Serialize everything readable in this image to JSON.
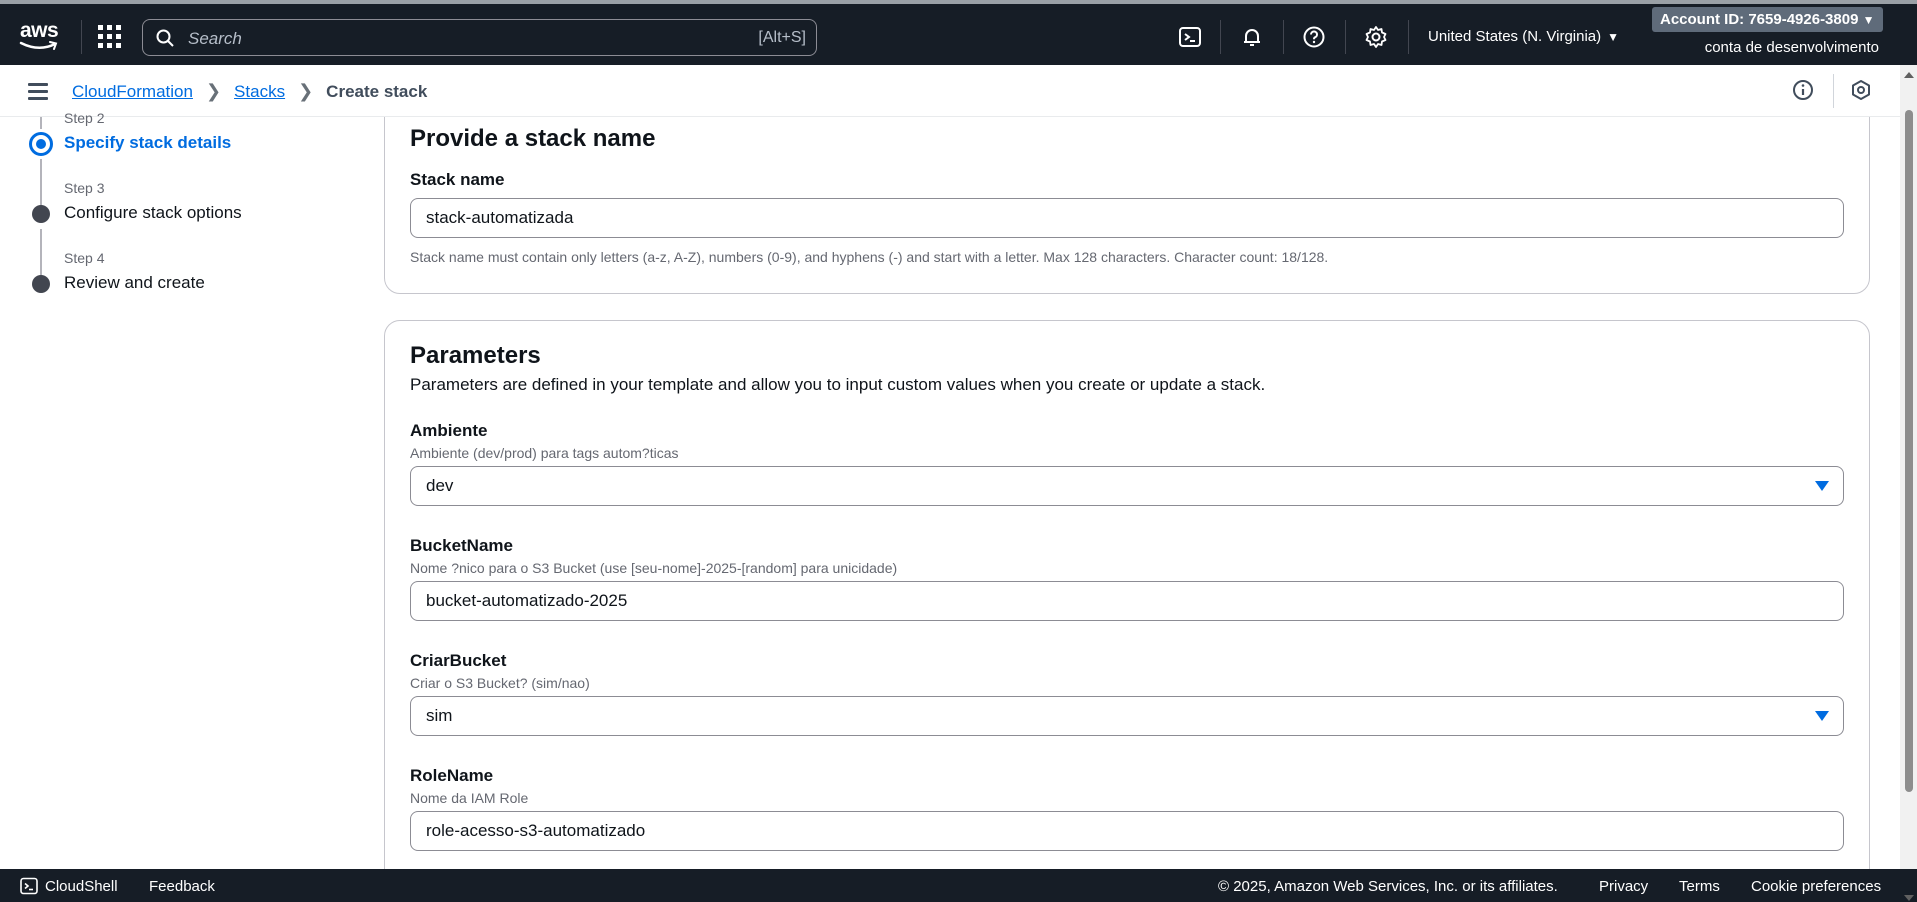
{
  "topnav": {
    "logo_text": "aws",
    "search_placeholder": "Search",
    "search_shortcut": "[Alt+S]",
    "region": "United States (N. Virginia)",
    "account_id": "Account ID: 7659-4926-3809",
    "account_alias": "conta de desenvolvimento"
  },
  "breadcrumb": {
    "items": [
      "CloudFormation",
      "Stacks"
    ],
    "current": "Create stack"
  },
  "steps": [
    {
      "number": "Step 2",
      "title": "Specify stack details",
      "active": true
    },
    {
      "number": "Step 3",
      "title": "Configure stack options",
      "active": false
    },
    {
      "number": "Step 4",
      "title": "Review and create",
      "active": false
    }
  ],
  "stack_name_section": {
    "heading": "Provide a stack name",
    "label": "Stack name",
    "value": "stack-automatizada",
    "constraint": "Stack name must contain only letters (a-z, A-Z), numbers (0-9), and hyphens (-) and start with a letter. Max 128 characters. Character count: 18/128."
  },
  "parameters": {
    "heading": "Parameters",
    "description": "Parameters are defined in your template and allow you to input custom values when you create or update a stack.",
    "fields": [
      {
        "name": "Ambiente",
        "description": "Ambiente (dev/prod) para tags autom?ticas",
        "value": "dev",
        "type": "select"
      },
      {
        "name": "BucketName",
        "description": "Nome ?nico para o S3 Bucket (use [seu-nome]-2025-[random] para unicidade)",
        "value": "bucket-automatizado-2025",
        "type": "text"
      },
      {
        "name": "CriarBucket",
        "description": "Criar o S3 Bucket? (sim/nao)",
        "value": "sim",
        "type": "select"
      },
      {
        "name": "RoleName",
        "description": "Nome da IAM Role",
        "value": "role-acesso-s3-automatizado",
        "type": "text"
      }
    ]
  },
  "footer": {
    "cloudshell": "CloudShell",
    "feedback": "Feedback",
    "copyright": "© 2025, Amazon Web Services, Inc. or its affiliates.",
    "privacy": "Privacy",
    "terms": "Terms",
    "cookies": "Cookie preferences"
  },
  "colors": {
    "nav_bg": "#161d26",
    "link_blue": "#006ce0",
    "text": "#0f141a",
    "muted": "#656871"
  }
}
